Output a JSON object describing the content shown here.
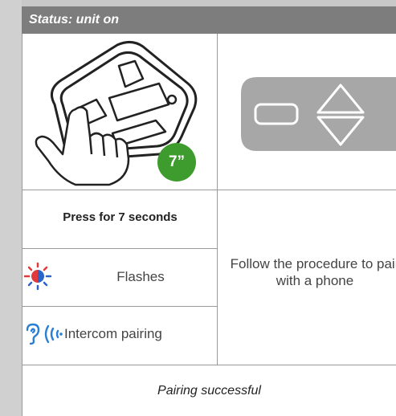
{
  "status_bar": {
    "text": "Status: unit on"
  },
  "image_badge": {
    "text": "7”"
  },
  "cells": {
    "press_instruction": "Press for 7 seconds",
    "led_state": "Flashes",
    "mode": "Intercom pairing",
    "procedure": "Follow the procedure to pair with a phone",
    "result": "Pairing successful"
  },
  "colors": {
    "status_bar": "#7d7d7d",
    "badge_green": "#3e9b2e",
    "led_red": "#e23a3a",
    "led_blue": "#2b64c8",
    "intercom_blue": "#2a7fd4",
    "grid_line": "#9a9a9a",
    "keypad_gray": "#a7a7a7"
  },
  "icons": {
    "device": "device-hand-press-icon",
    "keypad": "keypad-buttons-icon",
    "led": "led-flash-icon",
    "intercom": "intercom-ear-wave-icon"
  }
}
